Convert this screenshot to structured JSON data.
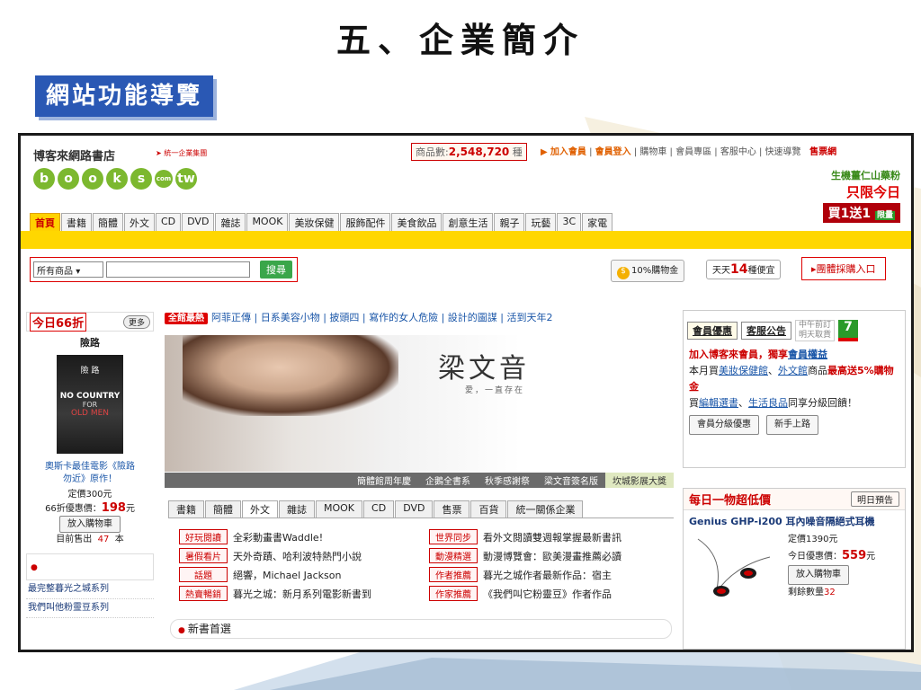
{
  "slide": {
    "title": "五、企業簡介",
    "section": "網站功能導覽"
  },
  "header": {
    "brand": "博客來網路書店",
    "brand_sub": "統一企業集團",
    "logo_letters": [
      "b",
      "o",
      "o",
      "k",
      "s",
      "com",
      "tw"
    ],
    "product_count_label": "商品數:",
    "product_count": "2,548,720",
    "product_count_unit": "種",
    "links": [
      "加入會員",
      "會員登入",
      "購物車",
      "會員專區",
      "客服中心",
      "快速導覽",
      "售票網"
    ],
    "promo": {
      "line1": "生機薑仁山藥粉",
      "line2": "只限今日",
      "line3": "買1送1",
      "line3_badge": "限量"
    }
  },
  "category_tabs": [
    "首頁",
    "書籍",
    "簡體",
    "外文",
    "CD",
    "DVD",
    "雜誌",
    "MOOK",
    "美妝保健",
    "服飾配件",
    "美食飲品",
    "創意生活",
    "親子",
    "玩藝",
    "3C",
    "家電"
  ],
  "search": {
    "category_value": "所有商品",
    "button": "搜尋"
  },
  "toolbar": {
    "cart_label": "10%購物金",
    "daily_prefix": "天天",
    "daily_num": "14",
    "daily_suffix": "種便宜",
    "group_buy": "團體採購入口"
  },
  "left": {
    "title": "今日66折",
    "more": "更多",
    "book_name": "險路",
    "cover": {
      "t1": "險 路",
      "t2": "NO COUNTRY",
      "t3": "FOR",
      "t4": "OLD MEN"
    },
    "desc1": "奧斯卡最佳電影《險路",
    "desc2": "勿近》原作！",
    "list_price": "定價300元",
    "discount_label": "66折優惠價：",
    "discount_price": "198",
    "discount_unit": "元",
    "add_cart": "放入購物車",
    "sold_prefix": "目前售出",
    "sold_count": "47",
    "sold_unit": "本",
    "list": [
      "最完整暮光之城系列",
      "我們叫他粉靈豆系列"
    ]
  },
  "news": {
    "badge": "全館最熱",
    "text": "阿菲正傳 | 日系美容小物 | 披頭四 | 寫作的女人危險 | 設計的圖謀 | 活到天年2"
  },
  "banner": {
    "name": "梁文音",
    "sub": "愛，一直存在",
    "tabs": [
      "簡體館周年慶",
      "企鵝全書系",
      "秋季感謝祭",
      "梁文音簽名版",
      "坎城影展大獎"
    ]
  },
  "product_tabs": [
    "書籍",
    "簡體",
    "外文",
    "雜誌",
    "MOOK",
    "CD",
    "DVD",
    "售票",
    "百貨",
    "統一關係企業"
  ],
  "product_rows": [
    [
      {
        "tag": "好玩閱讀",
        "text": "全彩動畫書Waddle!"
      },
      {
        "tag": "世界同步",
        "text": "看外文閱讀雙週報掌握最新書訊"
      }
    ],
    [
      {
        "tag": "暑假看片",
        "text": "天外奇蹟、哈利波特熱門小說"
      },
      {
        "tag": "動漫精選",
        "text": "動漫博覽會：歐美漫畫推薦必讀"
      }
    ],
    [
      {
        "tag": "話題",
        "text": "絕響，Michael Jackson"
      },
      {
        "tag": "作者推薦",
        "text": "暮光之城作者最新作品：宿主"
      }
    ],
    [
      {
        "tag": "熱賣暢銷",
        "text": "暮光之城：新月系列電影新書到"
      },
      {
        "tag": "作家推薦",
        "text": "《我們叫它粉靈豆》作者作品"
      }
    ]
  ],
  "new_books": "新書首選",
  "member": {
    "tab1": "會員優惠",
    "tab2": "客服公告",
    "note1": "中午前訂",
    "note2": "明天取貨",
    "line1_a": "加入博客來會員，獨享",
    "line1_b": "會員權益",
    "line2_a": "本月買",
    "line2_b": "美妝保健館",
    "line2_c": "、",
    "line2_d": "外文館",
    "line2_e": "商品",
    "line2_f": "最高送5%購物金",
    "line3_a": "買",
    "line3_b": "編輯選書",
    "line3_c": "、",
    "line3_d": "生活良品",
    "line3_e": "同享分級回饋！",
    "btn1": "會員分級優惠",
    "btn2": "新手上路"
  },
  "deal": {
    "title": "每日一物超低價",
    "next": "明日預告",
    "name": "Genius GHP-i200 耳內噪音隔絕式耳機",
    "list_price": "定價1390元",
    "today_label": "今日優惠價：",
    "today_price": "559",
    "today_unit": "元",
    "add_cart": "放入購物車",
    "qty_label": "剩餘數量",
    "qty": "32"
  }
}
